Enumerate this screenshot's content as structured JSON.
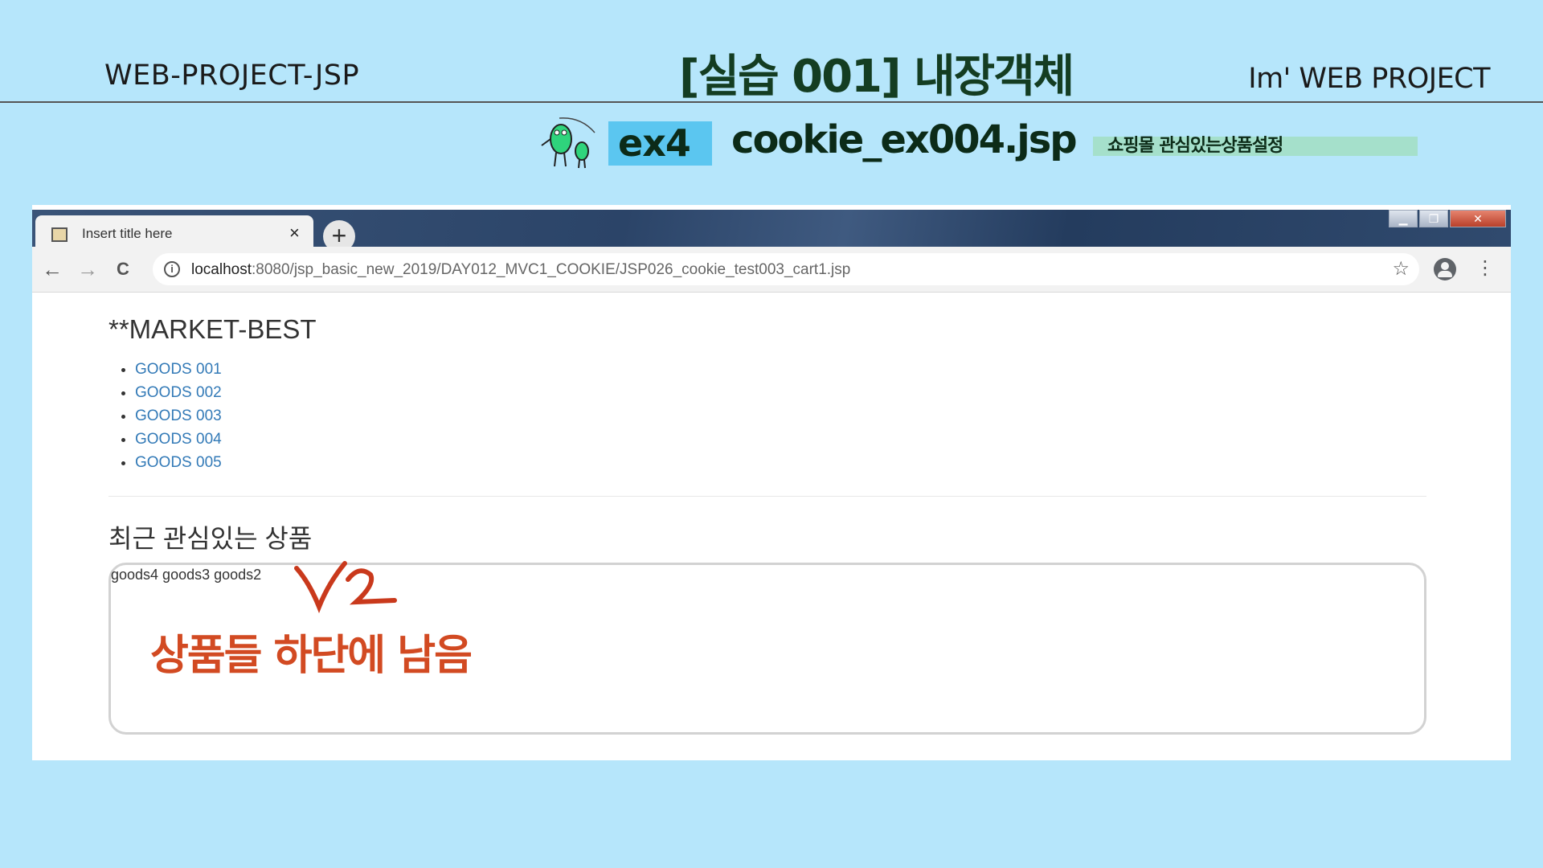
{
  "slide": {
    "left_title": "WEB-PROJECT-JSP",
    "main_title": "[실습 001]  내장객체",
    "right_title": "Im'  WEB PROJECT",
    "example_badge": "ex4",
    "file_name": "cookie_ex004.jsp",
    "topic": "쇼핑몰  관심있는상품설정"
  },
  "browser": {
    "tab_title": "Insert title here",
    "tab_close": "×",
    "new_tab": "+",
    "window_controls": {
      "minimize": "▁",
      "restore": "❐",
      "close": "✕"
    },
    "url_host": "localhost",
    "url_path": ":8080/jsp_basic_new_2019/DAY012_MVC1_COOKIE/JSP026_cookie_test003_cart1.jsp",
    "back_icon": "←",
    "forward_icon": "→",
    "reload_icon": "C",
    "star_icon": "☆",
    "menu_icon": "⋮"
  },
  "page": {
    "market_title": "**MARKET-BEST",
    "goods": [
      "GOODS 001",
      "GOODS 002",
      "GOODS 003",
      "GOODS 004",
      "GOODS 005"
    ],
    "recent_title": "최근 관심있는 상품",
    "recent_goods": "goods4 goods3 goods2",
    "annotation": "상품들 하단에 남음"
  },
  "colors": {
    "background": "#b6e6fb",
    "link": "#337ab7",
    "annotation": "#d24a22",
    "badge": "#5bc6f0",
    "topic_tag": "#a5e0cb"
  }
}
